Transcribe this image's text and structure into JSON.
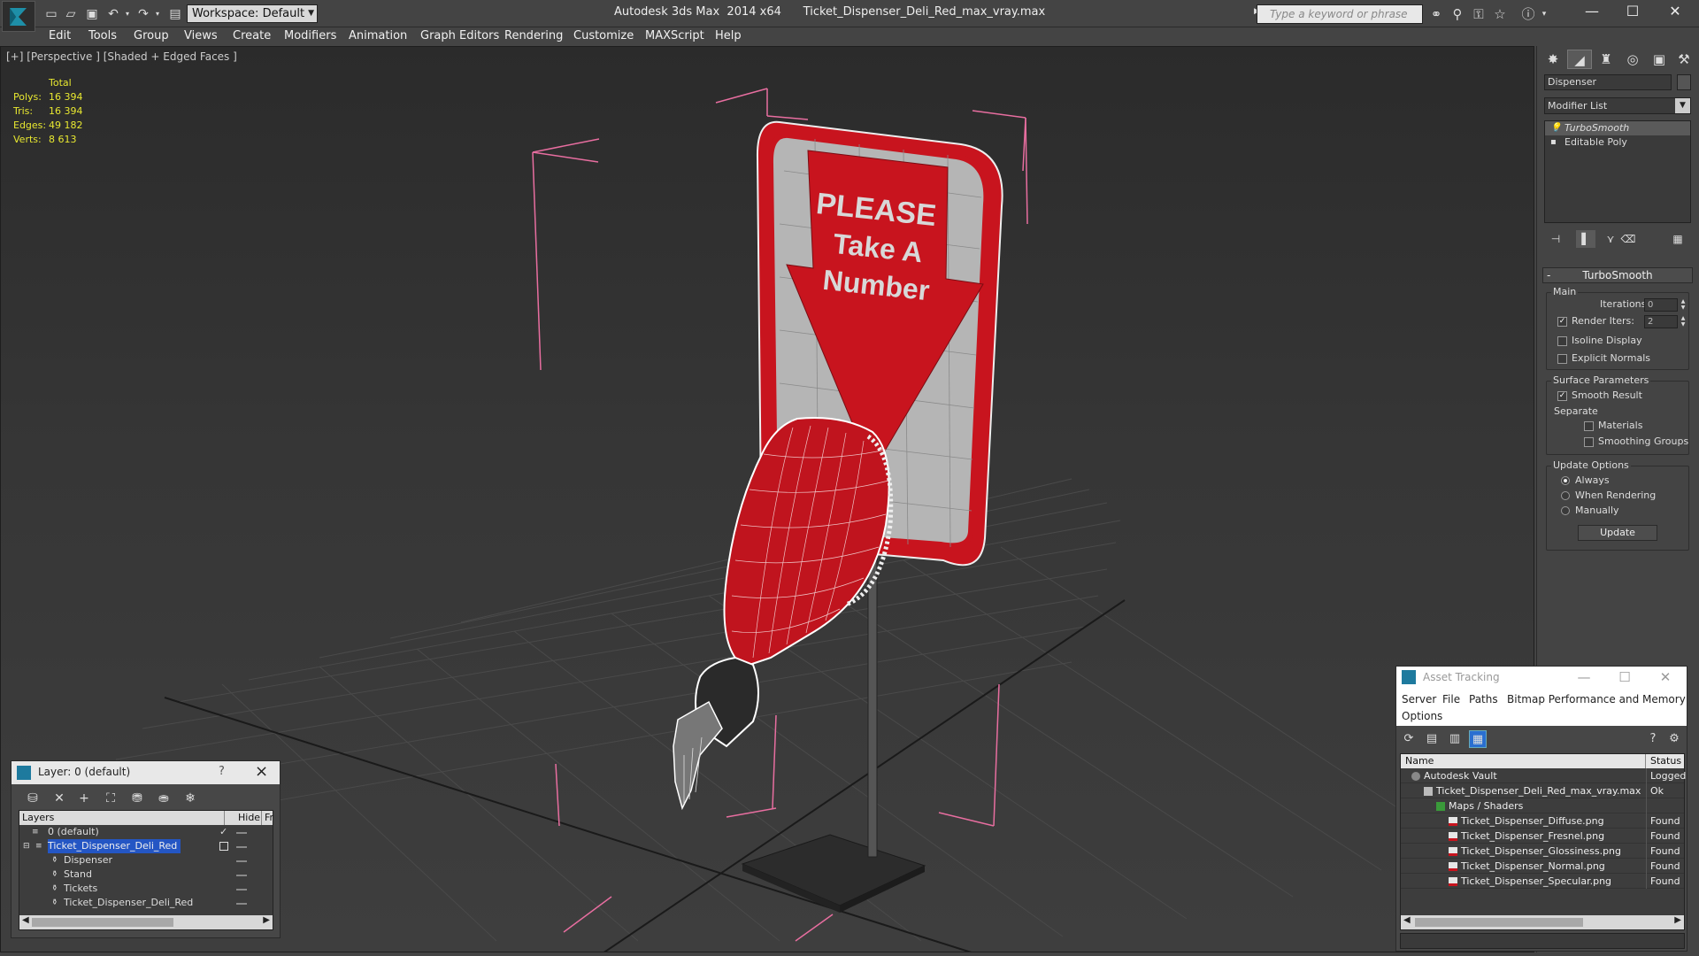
{
  "title_bar": {
    "workspace_label": "Workspace: Default",
    "window_title": "Autodesk 3ds Max  2014 x64      Ticket_Dispenser_Deli_Red_max_vray.max",
    "search_placeholder": "Type a keyword or phrase"
  },
  "menu": [
    "Edit",
    "Tools",
    "Group",
    "Views",
    "Create",
    "Modifiers",
    "Animation",
    "Graph Editors",
    "Rendering",
    "Customize",
    "MAXScript",
    "Help"
  ],
  "viewport": {
    "label": "[+] [Perspective ] [Shaded + Edged Faces ]",
    "stats": {
      "header": "Total",
      "rows": [
        {
          "label": "Polys:",
          "value": "16 394"
        },
        {
          "label": "Tris:",
          "value": "16 394"
        },
        {
          "label": "Edges:",
          "value": "49 182"
        },
        {
          "label": "Verts:",
          "value": "8 613"
        }
      ]
    },
    "sign_text": [
      "PLEASE",
      "Take A",
      "Number"
    ]
  },
  "command_panel": {
    "object_name": "Dispenser",
    "modifier_list_label": "Modifier List",
    "stack": [
      {
        "label": "TurboSmooth",
        "selected": true
      },
      {
        "label": "Editable Poly",
        "selected": false
      }
    ],
    "turbosmooth": {
      "title": "TurboSmooth",
      "main_group": "Main",
      "iterations_label": "Iterations:",
      "iterations_value": "0",
      "render_iters_label": "Render Iters:",
      "render_iters_value": "2",
      "isoline_label": "Isoline Display",
      "explicit_normals_label": "Explicit Normals",
      "surface_group": "Surface Parameters",
      "smooth_result_label": "Smooth Result",
      "separate_label": "Separate",
      "materials_label": "Materials",
      "smoothing_groups_label": "Smoothing Groups",
      "update_group": "Update Options",
      "always_label": "Always",
      "when_rendering_label": "When Rendering",
      "manually_label": "Manually",
      "update_button": "Update"
    }
  },
  "layer_window": {
    "title": "Layer: 0 (default)",
    "help": "?",
    "col_layers": "Layers",
    "col_hide": "Hide",
    "col_fr": "Fr",
    "rows": [
      {
        "name": "0 (default)",
        "indent": 0
      },
      {
        "name": "Ticket_Dispenser_Deli_Red",
        "indent": 1
      },
      {
        "name": "Dispenser",
        "indent": 2
      },
      {
        "name": "Stand",
        "indent": 2
      },
      {
        "name": "Tickets",
        "indent": 2
      },
      {
        "name": "Ticket_Dispenser_Deli_Red",
        "indent": 2
      }
    ]
  },
  "asset_window": {
    "title": "Asset Tracking",
    "menu": [
      "Server",
      "File",
      "Paths",
      "Bitmap Performance and Memory",
      "Options"
    ],
    "col_name": "Name",
    "col_status": "Status",
    "rows": [
      {
        "name": "Autodesk Vault",
        "status": "Logged",
        "level": 0,
        "icon": "vault-icon"
      },
      {
        "name": "Ticket_Dispenser_Deli_Red_max_vray.max",
        "status": "Ok",
        "level": 1,
        "icon": "max-file-icon"
      },
      {
        "name": "Maps / Shaders",
        "status": "",
        "level": 2,
        "icon": "maps-icon"
      },
      {
        "name": "Ticket_Dispenser_Diffuse.png",
        "status": "Found",
        "level": 3,
        "icon": "png-icon"
      },
      {
        "name": "Ticket_Dispenser_Fresnel.png",
        "status": "Found",
        "level": 3,
        "icon": "png-icon"
      },
      {
        "name": "Ticket_Dispenser_Glossiness.png",
        "status": "Found",
        "level": 3,
        "icon": "png-icon"
      },
      {
        "name": "Ticket_Dispenser_Normal.png",
        "status": "Found",
        "level": 3,
        "icon": "png-icon"
      },
      {
        "name": "Ticket_Dispenser_Specular.png",
        "status": "Found",
        "level": 3,
        "icon": "png-icon"
      }
    ]
  },
  "colors": {
    "accent_red": "#c8141e",
    "selection_blue": "#2456c4",
    "stats_yellow": "#e8e830",
    "bbox_pink": "#e86ea0"
  }
}
